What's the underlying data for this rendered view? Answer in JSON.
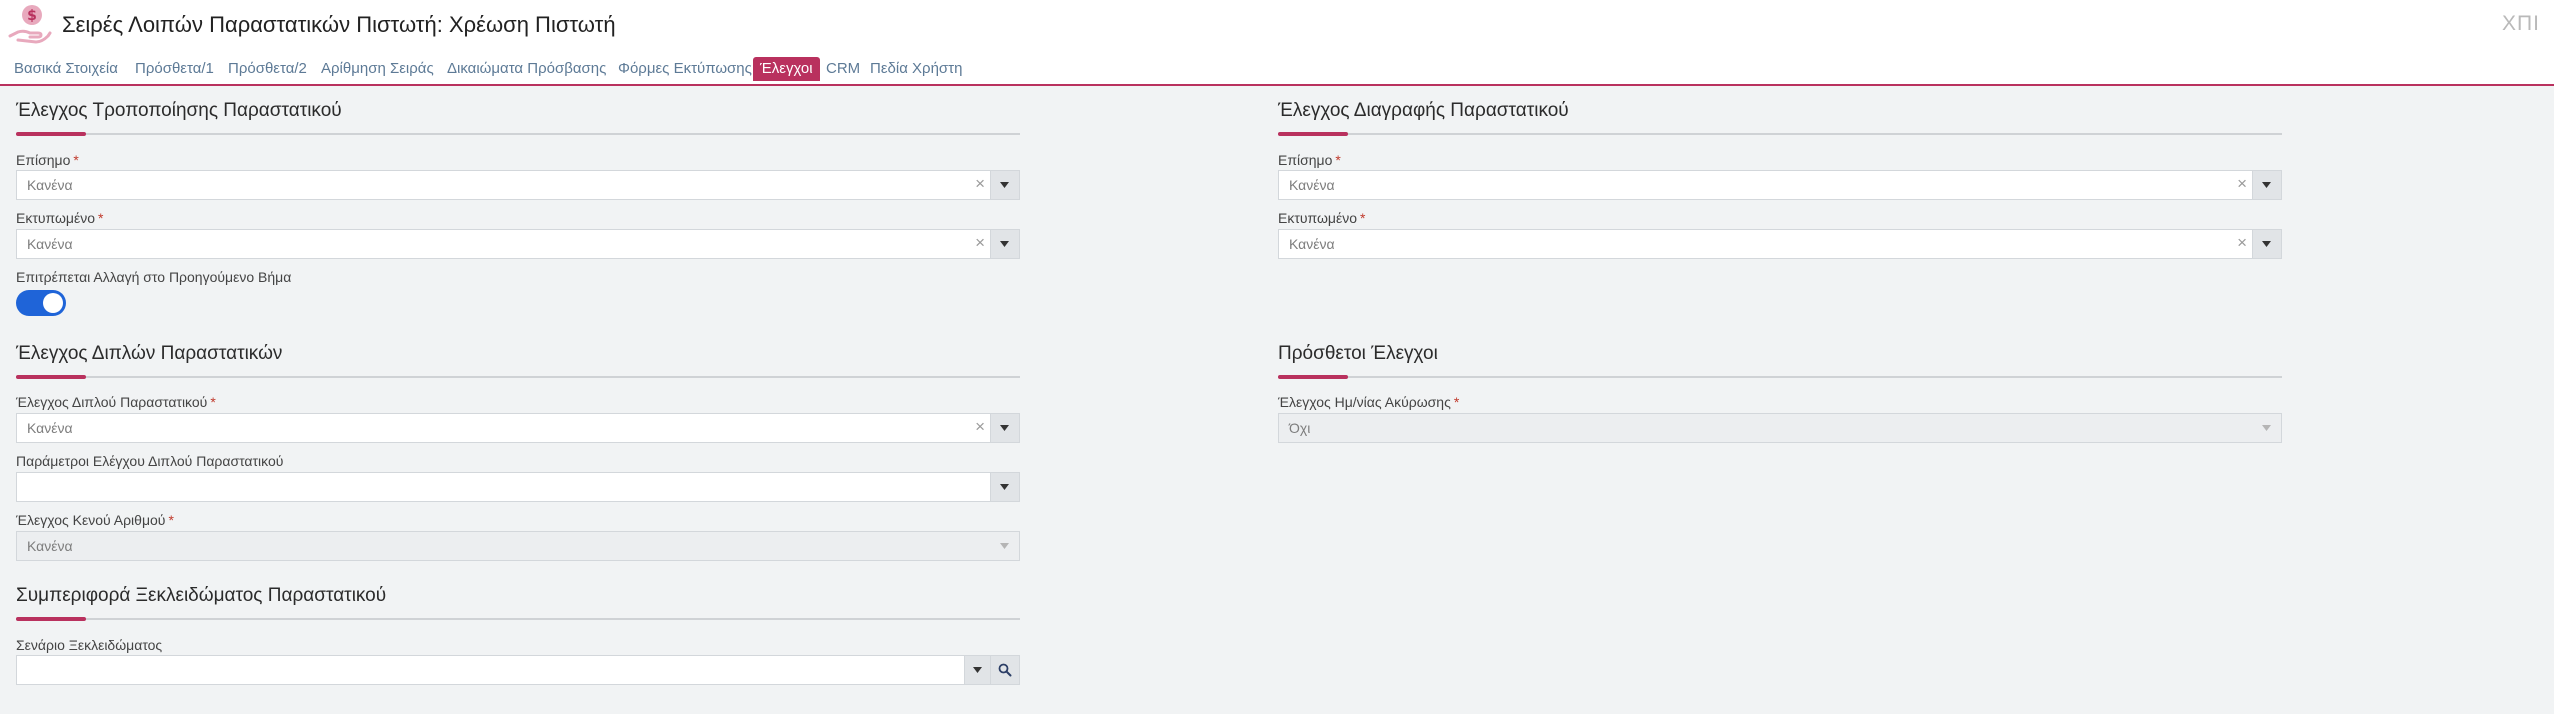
{
  "header": {
    "title": "Σειρές Λοιπών Παραστατικών Πιστωτή: Χρέωση Πιστωτή",
    "corner_text": "ΧΠΙ",
    "icon": "hand-dollar-icon",
    "accent_color": "#b9315e"
  },
  "tabs": [
    {
      "label": "Βασικά Στοιχεία",
      "active": false
    },
    {
      "label": "Πρόσθετα/1",
      "active": false
    },
    {
      "label": "Πρόσθετα/2",
      "active": false
    },
    {
      "label": "Αρίθμηση Σειράς",
      "active": false
    },
    {
      "label": "Δικαιώματα Πρόσβασης",
      "active": false
    },
    {
      "label": "Φόρμες Εκτύπωσης",
      "active": false
    },
    {
      "label": "Έλεγχοι",
      "active": true
    },
    {
      "label": "CRM",
      "active": false
    },
    {
      "label": "Πεδία Χρήστη",
      "active": false
    }
  ],
  "modify_section": {
    "title": "Έλεγχος Τροποποίησης Παραστατικού",
    "official": {
      "label": "Επίσημο",
      "required": "*",
      "value": "Κανένα"
    },
    "printed": {
      "label": "Εκτυπωμένο",
      "required": "*",
      "value": "Κανένα"
    },
    "allow_change": {
      "label": "Επιτρέπεται Αλλαγή στο Προηγούμενο Βήμα",
      "enabled": true
    }
  },
  "delete_section": {
    "title": "Έλεγχος Διαγραφής Παραστατικού",
    "official": {
      "label": "Επίσημο",
      "required": "*",
      "value": "Κανένα"
    },
    "printed": {
      "label": "Εκτυπωμένο",
      "required": "*",
      "value": "Κανένα"
    }
  },
  "duplicates_section": {
    "title": "Έλεγχος Διπλών Παραστατικών",
    "duplicate_check": {
      "label": "Έλεγχος Διπλού Παραστατικού",
      "required": "*",
      "value": "Κανένα"
    },
    "duplicate_params": {
      "label": "Παράμετροι Ελέγχου Διπλού Παραστατικού",
      "value": ""
    },
    "empty_number": {
      "label": "Έλεγχος Κενού Αριθμού",
      "required": "*",
      "value": "Κανένα"
    }
  },
  "extra_section": {
    "title": "Πρόσθετοι Έλεγχοι",
    "cancel_date": {
      "label": "Έλεγχος Ημ/νίας Ακύρωσης",
      "required": "*",
      "value": "Όχι"
    }
  },
  "unlock_section": {
    "title": "Συμπεριφορά Ξεκλειδώματος Παραστατικού",
    "scenario": {
      "label": "Σενάριο Ξεκλειδώματος",
      "value": ""
    }
  }
}
